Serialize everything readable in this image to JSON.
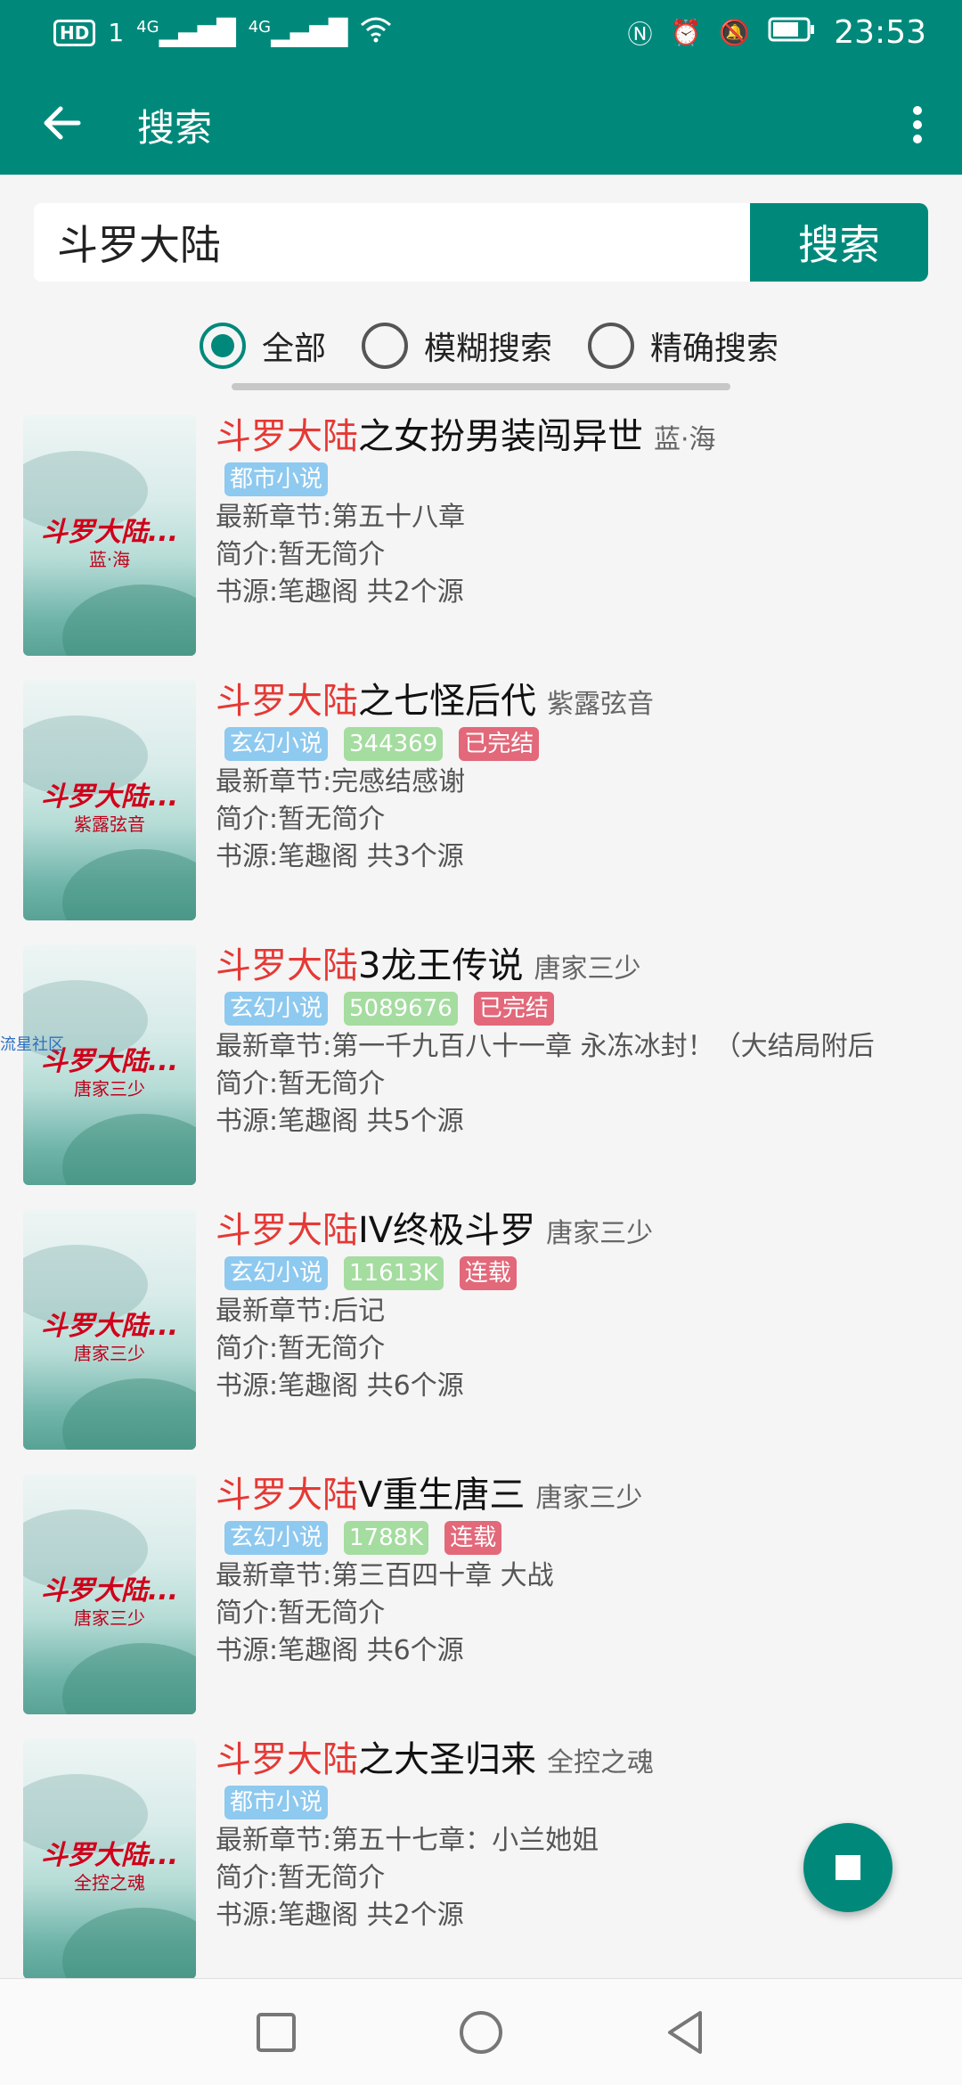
{
  "status_bar": {
    "left_indicators": [
      "HD",
      "1",
      "4G",
      "4G"
    ],
    "time": "23:53"
  },
  "app_bar": {
    "title": "搜索"
  },
  "search": {
    "value": "斗罗大陆",
    "button_label": "搜索"
  },
  "filters": [
    {
      "label": "全部",
      "checked": true
    },
    {
      "label": "模糊搜索",
      "checked": false
    },
    {
      "label": "精确搜索",
      "checked": false
    }
  ],
  "results": [
    {
      "title_highlight": "斗罗大陆",
      "title_rest": "之女扮男装闯异世",
      "author": "蓝·海",
      "cover_title": "斗罗大陆...",
      "cover_author": "蓝·海",
      "tags": [
        {
          "text": "都市小说",
          "type": "kind"
        }
      ],
      "latest": "最新章节:第五十八章",
      "intro": "简介:暂无简介",
      "source": "书源:笔趣阁 共2个源"
    },
    {
      "title_highlight": "斗罗大陆",
      "title_rest": "之七怪后代",
      "author": "紫露弦音",
      "cover_title": "斗罗大陆...",
      "cover_author": "紫露弦音",
      "tags": [
        {
          "text": "玄幻小说",
          "type": "kind"
        },
        {
          "text": "344369",
          "type": "words"
        },
        {
          "text": "已完结",
          "type": "state"
        }
      ],
      "latest": "最新章节:完感结感谢",
      "intro": "简介:暂无简介",
      "source": "书源:笔趣阁 共3个源"
    },
    {
      "title_highlight": "斗罗大陆",
      "title_rest": "3龙王传说",
      "author": "唐家三少",
      "cover_title": "斗罗大陆...",
      "cover_author": "唐家三少",
      "tags": [
        {
          "text": "玄幻小说",
          "type": "kind"
        },
        {
          "text": "5089676",
          "type": "words"
        },
        {
          "text": "已完结",
          "type": "state"
        }
      ],
      "latest": "最新章节:第一千九百八十一章 永冻冰封！（大结局附后",
      "intro": "简介:暂无简介",
      "source": "书源:笔趣阁 共5个源"
    },
    {
      "title_highlight": "斗罗大陆",
      "title_rest": "IV终极斗罗",
      "author": "唐家三少",
      "cover_title": "斗罗大陆...",
      "cover_author": "唐家三少",
      "tags": [
        {
          "text": "玄幻小说",
          "type": "kind"
        },
        {
          "text": "11613K",
          "type": "words"
        },
        {
          "text": "连载",
          "type": "state"
        }
      ],
      "latest": "最新章节:后记",
      "intro": "简介:暂无简介",
      "source": "书源:笔趣阁 共6个源"
    },
    {
      "title_highlight": "斗罗大陆",
      "title_rest": "V重生唐三",
      "author": "唐家三少",
      "cover_title": "斗罗大陆...",
      "cover_author": "唐家三少",
      "tags": [
        {
          "text": "玄幻小说",
          "type": "kind"
        },
        {
          "text": "1788K",
          "type": "words"
        },
        {
          "text": "连载",
          "type": "state"
        }
      ],
      "latest": "最新章节:第三百四十章 大战",
      "intro": "简介:暂无简介",
      "source": "书源:笔趣阁 共6个源"
    },
    {
      "title_highlight": "斗罗大陆",
      "title_rest": "之大圣归来",
      "author": "全控之魂",
      "cover_title": "斗罗大陆...",
      "cover_author": "全控之魂",
      "tags": [
        {
          "text": "都市小说",
          "type": "kind"
        }
      ],
      "latest": "最新章节:第五十七章：小兰她姐",
      "intro": "简介:暂无简介",
      "source": "书源:笔趣阁 共2个源"
    }
  ],
  "watermark": "流星社区",
  "icons": {
    "back": "arrow-left-icon",
    "menu": "more-vert-icon",
    "fab": "stop-icon",
    "nav": [
      "recent-apps-icon",
      "home-icon",
      "back-triangle-icon"
    ]
  },
  "colors": {
    "primary": "#00897b",
    "highlight": "#e53935",
    "tag_kind": "#8ec9ef",
    "tag_words": "#a5dca0",
    "tag_state": "#e2687a"
  }
}
